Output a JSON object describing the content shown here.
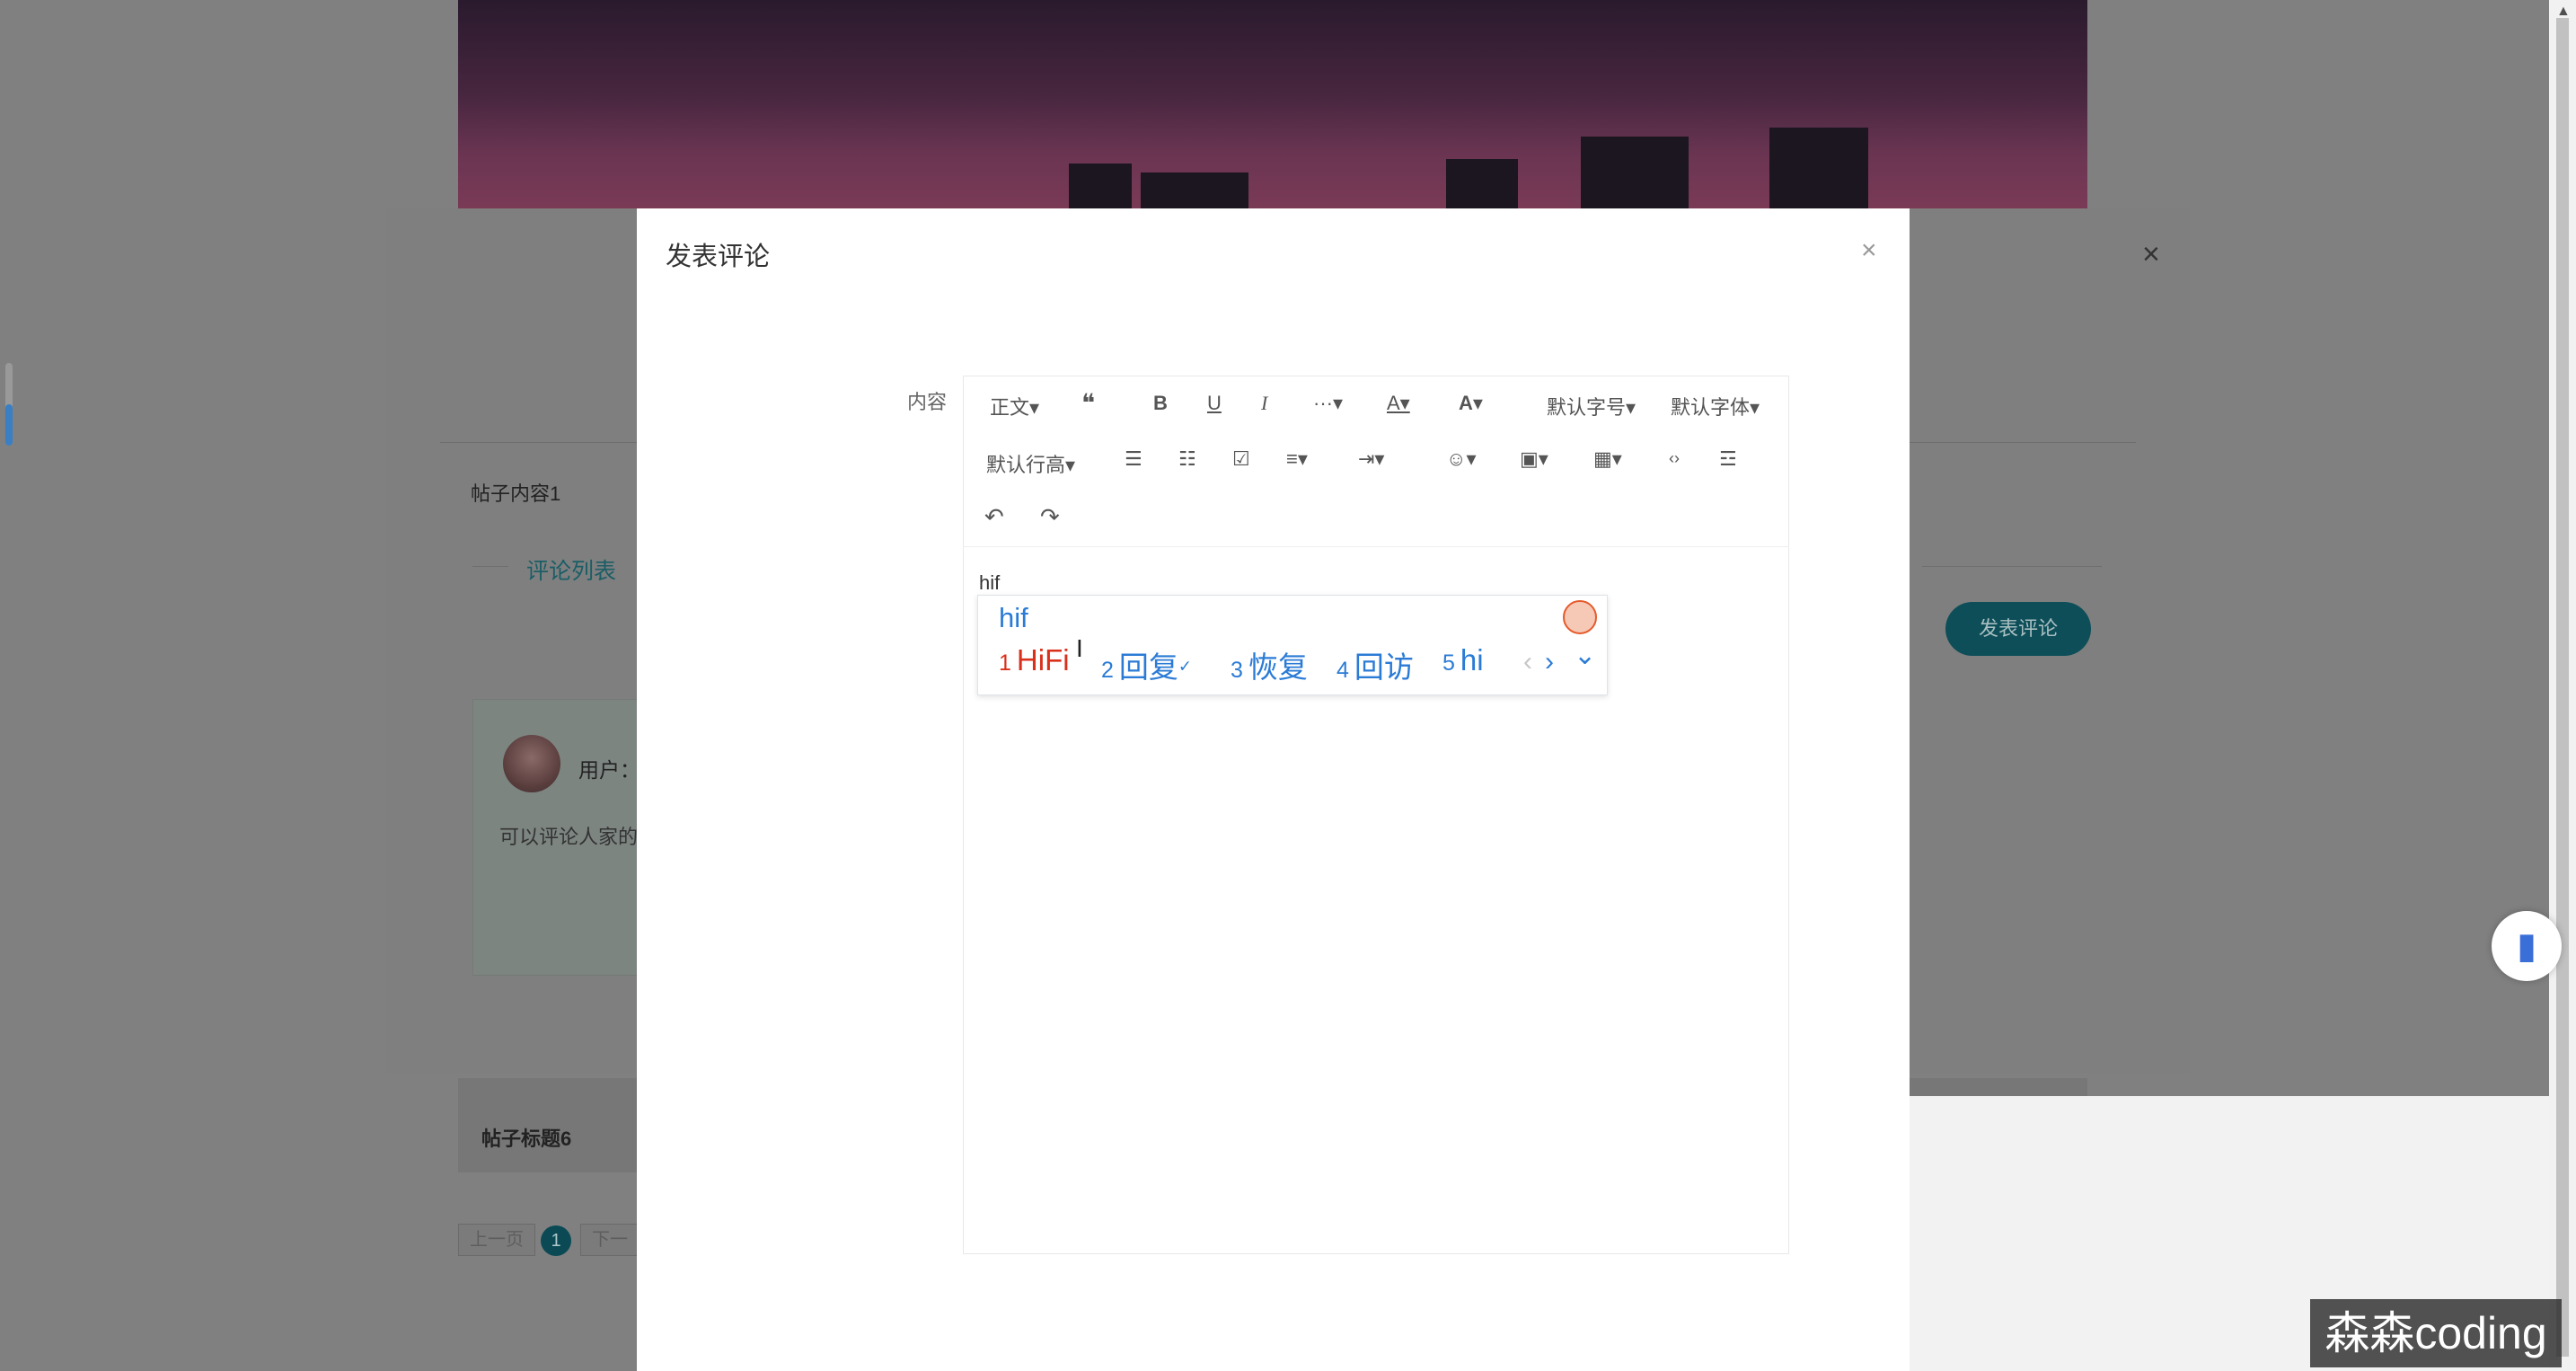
{
  "background_page": {
    "post_content": "帖子内容1",
    "comment_list_tab": "评论列表",
    "post_comment_button": "发表评论",
    "comment_user_label": "用户：",
    "comment_text": "可以评论人家的",
    "next_post_title": "帖子标题6",
    "pager": {
      "prev": "上一页",
      "current": "1",
      "next": "下一"
    },
    "close_glyph": "×"
  },
  "modal": {
    "title": "发表评论",
    "close_glyph": "×",
    "field_label": "内容"
  },
  "editor": {
    "toolbar_row1": [
      {
        "id": "paragraph",
        "label": "正文▾"
      },
      {
        "id": "quote",
        "label": "❝"
      },
      {
        "id": "bold",
        "label": "B"
      },
      {
        "id": "underline",
        "label": "U"
      },
      {
        "id": "italic",
        "label": "I"
      },
      {
        "id": "more",
        "label": "···▾"
      },
      {
        "id": "font-color",
        "label": "A▾"
      },
      {
        "id": "bg-color",
        "label": "A▾"
      },
      {
        "id": "font-size",
        "label": "默认字号▾"
      },
      {
        "id": "font-family",
        "label": "默认字体▾"
      }
    ],
    "toolbar_row2": [
      {
        "id": "line-height",
        "label": "默认行高▾"
      },
      {
        "id": "bullet-list",
        "label": "☰"
      },
      {
        "id": "numbered-list",
        "label": "☷"
      },
      {
        "id": "todo",
        "label": "☑"
      },
      {
        "id": "align",
        "label": "≡▾"
      },
      {
        "id": "indent",
        "label": "⇥▾"
      },
      {
        "id": "emoji",
        "label": "☺▾"
      },
      {
        "id": "image",
        "label": "▣▾"
      },
      {
        "id": "table",
        "label": "▦▾"
      },
      {
        "id": "code",
        "label": "‹›"
      },
      {
        "id": "divider",
        "label": "☲"
      }
    ],
    "toolbar_row3": [
      {
        "id": "undo",
        "label": "↶"
      },
      {
        "id": "redo",
        "label": "↷"
      }
    ],
    "content": "hif"
  },
  "ime": {
    "composition": "hif",
    "candidates": [
      {
        "num": "1",
        "word": "HiFi"
      },
      {
        "num": "2",
        "word": "回复"
      },
      {
        "num": "3",
        "word": "恢复"
      },
      {
        "num": "4",
        "word": "回访"
      },
      {
        "num": "5",
        "word": "hi"
      }
    ],
    "check_glyph": "✓",
    "prev_glyph": "‹",
    "next_glyph": "›",
    "expand_glyph": "⌄",
    "text_cursor_glyph": "I"
  },
  "watermark": "森森coding",
  "colors": {
    "accent": "#0d4e58",
    "ime_blue": "#2b7bd6",
    "ime_first": "#d9301c"
  }
}
